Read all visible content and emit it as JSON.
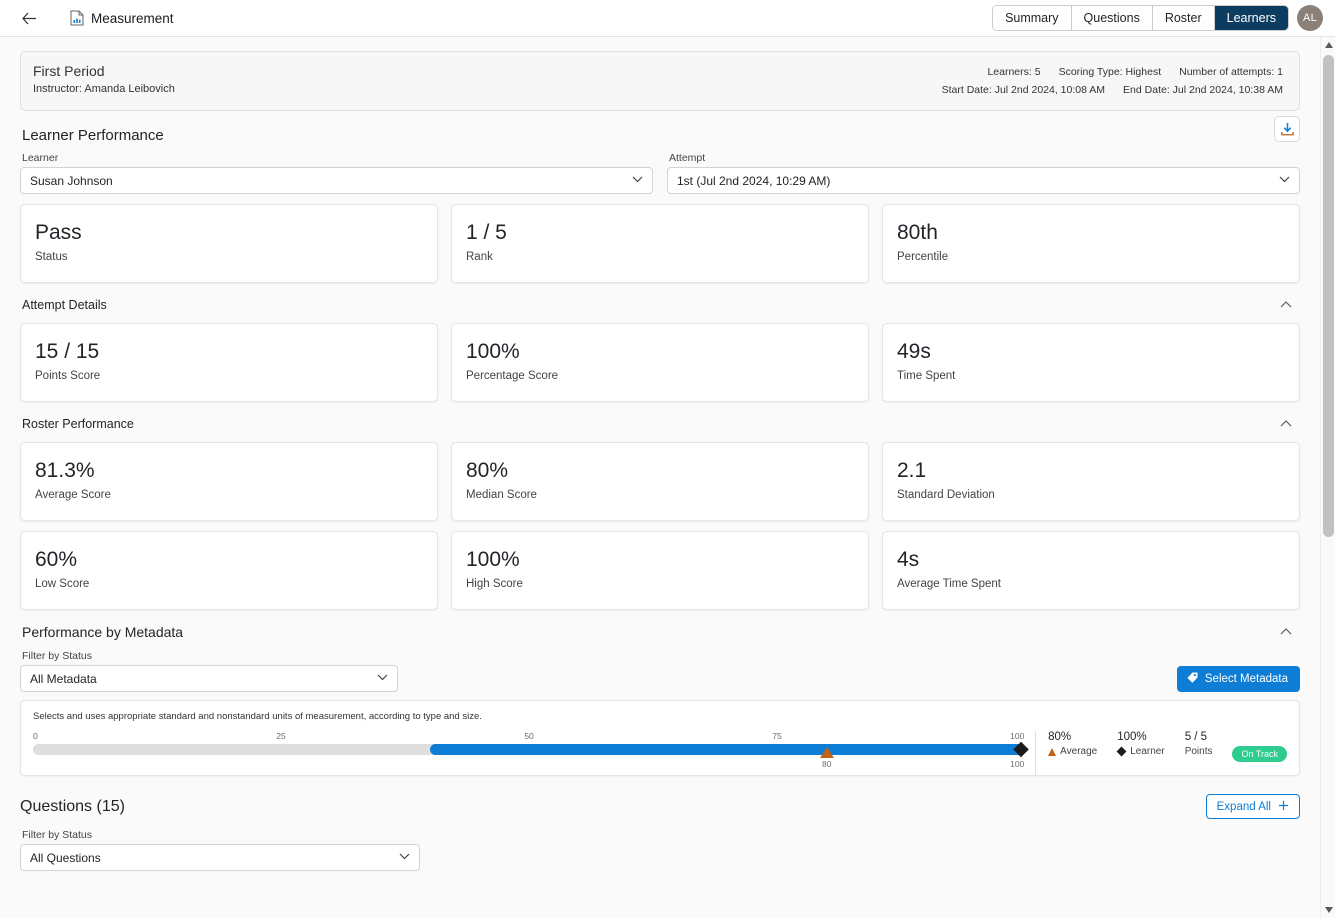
{
  "topbar": {
    "back_label": "←",
    "doc_icon": "document-chart-icon",
    "title": "Measurement",
    "tabs": [
      {
        "label": "Summary",
        "active": false
      },
      {
        "label": "Questions",
        "active": false
      },
      {
        "label": "Roster",
        "active": false
      },
      {
        "label": "Learners",
        "active": true
      }
    ],
    "avatar_initials": "AL"
  },
  "info": {
    "period": "First Period",
    "instructor": "Instructor: Amanda Leibovich",
    "learners": "Learners: 5",
    "scoring_type": "Scoring Type: Highest",
    "number_of_attempts": "Number of attempts: 1",
    "start_date": "Start Date: Jul 2nd 2024, 10:08 AM",
    "end_date": "End Date: Jul 2nd 2024, 10:38 AM"
  },
  "learner_performance": {
    "title": "Learner Performance",
    "download_icon": "download-icon",
    "learner_label": "Learner",
    "learner_value": "Susan Johnson",
    "attempt_label": "Attempt",
    "attempt_value": "1st (Jul 2nd 2024, 10:29 AM)",
    "cards": [
      {
        "value": "Pass",
        "caption": "Status"
      },
      {
        "value": "1 / 5",
        "caption": "Rank"
      },
      {
        "value": "80th",
        "caption": "Percentile"
      }
    ]
  },
  "attempt_details": {
    "title": "Attempt Details",
    "collapse_icon": "chevron-up-icon",
    "cards": [
      {
        "value": "15 / 15",
        "caption": "Points Score"
      },
      {
        "value": "100%",
        "caption": "Percentage Score"
      },
      {
        "value": "49s",
        "caption": "Time Spent"
      }
    ]
  },
  "roster_performance": {
    "title": "Roster Performance",
    "collapse_icon": "chevron-up-icon",
    "cards_row1": [
      {
        "value": "81.3%",
        "caption": "Average Score"
      },
      {
        "value": "80%",
        "caption": "Median Score"
      },
      {
        "value": "2.1",
        "caption": "Standard Deviation"
      }
    ],
    "cards_row2": [
      {
        "value": "60%",
        "caption": "Low Score"
      },
      {
        "value": "100%",
        "caption": "High Score"
      },
      {
        "value": "4s",
        "caption": "Average Time Spent"
      }
    ]
  },
  "performance_by_metadata": {
    "title": "Performance by Metadata",
    "collapse_icon": "chevron-up-icon",
    "filter_label": "Filter by Status",
    "filter_value": "All Metadata",
    "select_metadata_button": "Select Metadata",
    "tag_icon": "tag-icon",
    "item": {
      "description": "Selects and uses appropriate standard and nonstandard units of measurement, according to type and size.",
      "average_pct": "80%",
      "average_caption": "Average",
      "learner_pct": "100%",
      "learner_caption": "Learner",
      "points": "5 / 5",
      "points_caption": "Points",
      "status_badge": "On Track"
    }
  },
  "chart_data": {
    "type": "bar",
    "title": "Selects and uses appropriate standard and nonstandard units of measurement, according to type and size.",
    "xlabel": "",
    "ylabel": "",
    "xlim": [
      0,
      100
    ],
    "grid": false,
    "legend_position": "right",
    "tick_labels": [
      "0",
      "25",
      "50",
      "75",
      "100"
    ],
    "ticks": [
      0,
      25,
      50,
      75,
      100
    ],
    "range_fill": {
      "start": 40,
      "end": 100,
      "color": "#0d7dd6"
    },
    "track_color": "#dedede",
    "markers": [
      {
        "name": "Average",
        "value": 80,
        "label": "80",
        "symbol": "triangle",
        "color": "#c1621a"
      },
      {
        "name": "Learner",
        "value": 100,
        "label": "100",
        "symbol": "diamond",
        "color": "#1b1b1b"
      }
    ],
    "legend": [
      {
        "value": "80%",
        "label": "Average",
        "symbol": "triangle"
      },
      {
        "value": "100%",
        "label": "Learner",
        "symbol": "diamond"
      },
      {
        "value": "5 / 5",
        "label": "Points",
        "symbol": "none"
      }
    ],
    "status": "On Track",
    "status_color": "#2ecc8f"
  },
  "questions": {
    "title": "Questions (15)",
    "expand_all": "Expand All",
    "plus_icon": "plus-icon",
    "filter_label": "Filter by Status",
    "filter_value": "All Questions"
  },
  "colors": {
    "accent": "#0d7dd6",
    "active_tab": "#0d3c61",
    "average_marker": "#c1621a",
    "status_ontrack": "#2ecc8f"
  }
}
